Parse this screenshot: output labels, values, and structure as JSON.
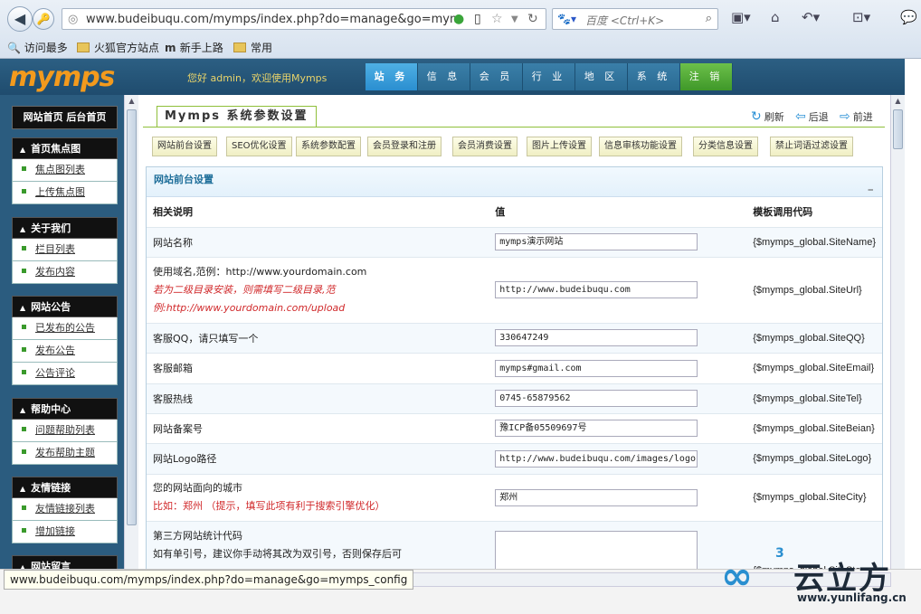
{
  "browser": {
    "url": "www.budeibuqu.com/mymps/index.php?do=manage&go=mymps_cc",
    "search_placeholder": "百度 <Ctrl+K>",
    "bookmarks": [
      "访问最多",
      "火狐官方站点",
      "新手上路",
      "常用"
    ]
  },
  "header": {
    "logo": "mymps",
    "welcome": "您好 admin，欢迎使用Mymps",
    "nav": [
      "站 务",
      "信 息",
      "会 员",
      "行 业",
      "地 区",
      "系 统",
      "注 销"
    ]
  },
  "sidebar": {
    "top": "网站首页 后台首页",
    "groups": [
      {
        "title": "首页焦点图",
        "items": [
          "焦点图列表",
          "上传焦点图"
        ]
      },
      {
        "title": "关于我们",
        "items": [
          "栏目列表",
          "发布内容"
        ]
      },
      {
        "title": "网站公告",
        "items": [
          "已发布的公告",
          "发布公告",
          "公告评论"
        ]
      },
      {
        "title": "帮助中心",
        "items": [
          "问题帮助列表",
          "发布帮助主题"
        ]
      },
      {
        "title": "友情链接",
        "items": [
          "友情链接列表",
          "增加链接"
        ]
      },
      {
        "title": "网站留言",
        "items": []
      }
    ]
  },
  "main": {
    "title": "Mymps 系统参数设置",
    "actions": {
      "refresh": "刷新",
      "back": "后退",
      "forward": "前进"
    },
    "subtabs": [
      "网站前台设置",
      "SEO优化设置",
      "系统参数配置",
      "会员登录和注册",
      "会员消费设置",
      "图片上传设置",
      "信息审核功能设置",
      "分类信息设置",
      "禁止词语过滤设置"
    ],
    "panel_title": "网站前台设置",
    "panel_min": "_",
    "columns": [
      "相关说明",
      "值",
      "模板调用代码"
    ],
    "rows": [
      {
        "desc": "网站名称",
        "note": "",
        "value": "mymps演示网站",
        "code": "{$mymps_global.SiteName}"
      },
      {
        "desc": "使用域名,范例：http://www.yourdomain.com",
        "note": "若为二级目录安装，则需填写二级目录,范例:http://www.yourdomain.com/upload",
        "value": "http://www.budeibuqu.com",
        "code": "{$mymps_global.SiteUrl}"
      },
      {
        "desc": "客服QQ，请只填写一个",
        "note": "",
        "value": "330647249",
        "code": "{$mymps_global.SiteQQ}"
      },
      {
        "desc": "客服邮箱",
        "note": "",
        "value": "mymps#gmail.com",
        "code": "{$mymps_global.SiteEmail}"
      },
      {
        "desc": "客服热线",
        "note": "",
        "value": "0745-65879562",
        "code": "{$mymps_global.SiteTel}"
      },
      {
        "desc": "网站备案号",
        "note": "",
        "value": "豫ICP备05509697号",
        "code": "{$mymps_global.SiteBeian}"
      },
      {
        "desc": "网站Logo路径",
        "note": "",
        "value": "http://www.budeibuqu.com/images/logo.gif",
        "code": "{$mymps_global.SiteLogo}"
      },
      {
        "desc": "您的网站面向的城市",
        "note": "比如：郑州 （提示，填写此项有利于搜索引擎优化）",
        "value": "郑州",
        "code": "{$mymps_global.SiteCity}"
      },
      {
        "desc": "第三方网站统计代码",
        "note": "",
        "desc2": "如有单引号，建议你手动将其改为双引号，否则保存后可",
        "value": "",
        "code": "{$mymps_global.SiteSta"
      }
    ]
  },
  "status_url": "www.budeibuqu.com/mymps/index.php?do=manage&go=mymps_config",
  "watermark": {
    "text": "云立方",
    "sup": "3",
    "url": "www.yunlifang.cn"
  }
}
